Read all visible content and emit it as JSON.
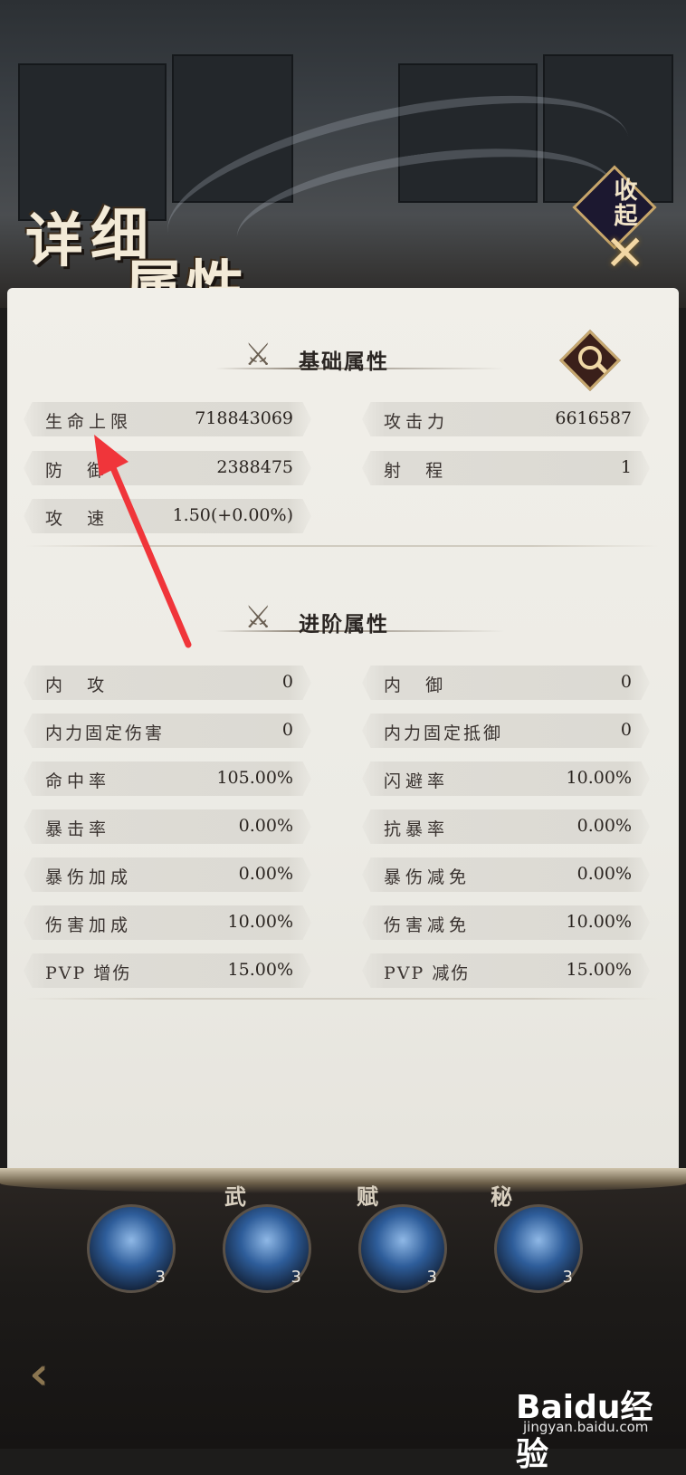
{
  "header": {
    "title_chars": [
      "详",
      "细",
      "属",
      "性"
    ],
    "collapse_label": "收起"
  },
  "basic": {
    "title": "基础属性",
    "stats": [
      {
        "label": "生命上限",
        "value": "718843069"
      },
      {
        "label": "攻击力",
        "value": "6616587"
      },
      {
        "label": "防  御",
        "value": "2388475"
      },
      {
        "label": "射  程",
        "value": "1"
      },
      {
        "label": "攻  速",
        "value": "1.50(+0.00%)"
      }
    ]
  },
  "advanced": {
    "title": "进阶属性",
    "stats": [
      {
        "label": "内  攻",
        "value": "0"
      },
      {
        "label": "内  御",
        "value": "0"
      },
      {
        "label": "内力固定伤害",
        "value": "0"
      },
      {
        "label": "内力固定抵御",
        "value": "0"
      },
      {
        "label": "命中率",
        "value": "105.00%"
      },
      {
        "label": "闪避率",
        "value": "10.00%"
      },
      {
        "label": "暴击率",
        "value": "0.00%"
      },
      {
        "label": "抗暴率",
        "value": "0.00%"
      },
      {
        "label": "暴伤加成",
        "value": "0.00%"
      },
      {
        "label": "暴伤减免",
        "value": "0.00%"
      },
      {
        "label": "伤害加成",
        "value": "10.00%"
      },
      {
        "label": "伤害减免",
        "value": "10.00%"
      },
      {
        "label": "PVP 增伤",
        "value": "15.00%"
      },
      {
        "label": "PVP 减伤",
        "value": "15.00%"
      }
    ]
  },
  "skills": [
    {
      "tag": "",
      "level": "3"
    },
    {
      "tag": "武",
      "level": "3"
    },
    {
      "tag": "赋",
      "level": "3"
    },
    {
      "tag": "秘",
      "level": "3"
    }
  ],
  "watermark": {
    "brand": "Baidu经验",
    "site": "jingyan.baidu.com"
  },
  "colors": {
    "panel": "#ecebe5",
    "annotation_arrow": "#f0353a",
    "accent_gold": "#c7a66a"
  }
}
